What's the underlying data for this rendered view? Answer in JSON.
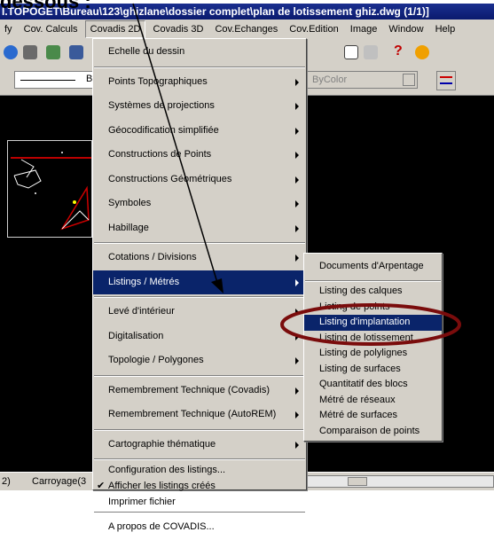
{
  "caption": "dessous :",
  "titlebar": {
    "title": "I.TOPOGET\\Bureau\\123\\ghizlane\\dossier complet\\plan de lotissement ghiz.dwg (1/1)]"
  },
  "menubar": {
    "items": [
      "fy",
      "Cov. Calculs",
      "Covadis 2D",
      "Covadis 3D",
      "Cov.Echanges",
      "Cov.Edition",
      "Image",
      "Window",
      "Help"
    ]
  },
  "toolbar": {
    "linetype_label": "B",
    "color_value": "ByColor"
  },
  "main_menu": {
    "items": [
      {
        "label": "Echelle du dessin",
        "sub": false
      },
      {
        "label": "Points Topographiques",
        "sub": true
      },
      {
        "label": "Systèmes de projections",
        "sub": true
      },
      {
        "label": "Géocodification simplifiée",
        "sub": true
      },
      {
        "label": "Constructions de Points",
        "sub": true
      },
      {
        "label": "Constructions Géométriques",
        "sub": true
      },
      {
        "label": "Symboles",
        "sub": true
      },
      {
        "label": "Habillage",
        "sub": true
      },
      {
        "label": "Cotations / Divisions",
        "sub": true
      },
      {
        "label": "Listings / Métrés",
        "sub": true,
        "selected": true
      },
      {
        "label": "Levé d'intérieur",
        "sub": true
      },
      {
        "label": "Digitalisation",
        "sub": true
      },
      {
        "label": "Topologie / Polygones",
        "sub": true
      },
      {
        "label": "Remembrement Technique (Covadis)",
        "sub": true
      },
      {
        "label": "Remembrement Technique (AutoREM)",
        "sub": true
      },
      {
        "label": "Cartographie thématique",
        "sub": true
      },
      {
        "label": "Configuration des listings...",
        "sub": false
      },
      {
        "label": "Afficher les listings créés",
        "sub": false,
        "checked": true
      },
      {
        "label": "Imprimer fichier",
        "sub": false
      },
      {
        "label": "A propos de COVADIS...",
        "sub": false
      }
    ]
  },
  "sub_menu": {
    "items": [
      "Documents d'Arpentage",
      "Listing des calques",
      "Listing de points",
      "Listing d'implantation",
      "Listing de lotissement",
      "Listing de polylignes",
      "Listing de surfaces",
      "Quantitatif des blocs",
      "Métré de réseaux",
      "Métré de surfaces",
      "Comparaison de points"
    ],
    "selected_index": 3
  },
  "statusbar": {
    "tab1": "2)",
    "tab2": "Carroyage(3"
  },
  "colors": {
    "highlight": "#0a246a",
    "annotation_ellipse": "#7a0c0c",
    "face": "#d4d0c8"
  }
}
